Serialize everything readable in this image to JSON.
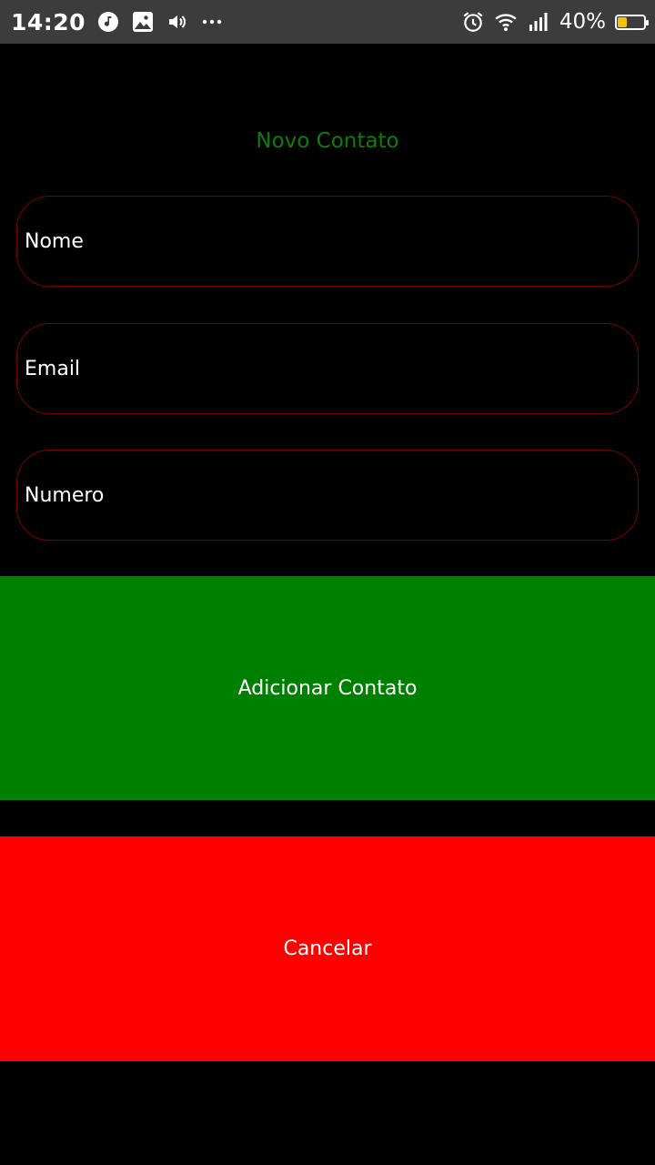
{
  "status_bar": {
    "time": "14:20",
    "battery_text": "40%",
    "battery_level": 0.4,
    "icons_left": [
      "music-icon",
      "image-icon",
      "volume-icon",
      "more-dots-icon"
    ],
    "icons_right": [
      "alarm-icon",
      "wifi-icon",
      "signal-icon",
      "battery-icon"
    ]
  },
  "form": {
    "title": "Novo Contato",
    "fields": {
      "name_placeholder": "Nome",
      "email_placeholder": "Email",
      "number_placeholder": "Numero"
    },
    "add_button_label": "Adicionar Contato",
    "cancel_button_label": "Cancelar"
  },
  "colors": {
    "background": "#000000",
    "title": "#0a7d0a",
    "field_border": "#7a0000",
    "add_button": "#008000",
    "cancel_button": "#ff0000"
  }
}
